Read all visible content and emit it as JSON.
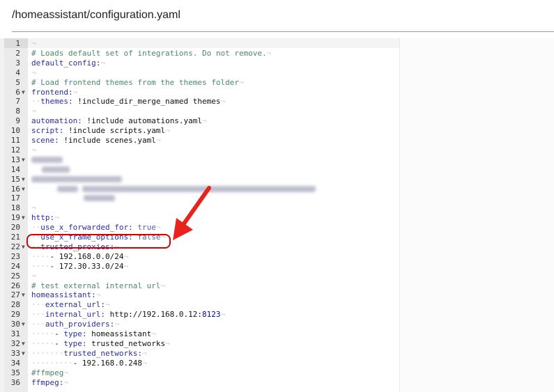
{
  "file": {
    "path": "/homeassistant/configuration.yaml"
  },
  "editor": {
    "lines": [
      {
        "n": "1",
        "code": ""
      },
      {
        "n": "2",
        "code": "# Loads default set of integrations. Do not remove."
      },
      {
        "n": "3",
        "code": "default_config:"
      },
      {
        "n": "4",
        "code": ""
      },
      {
        "n": "5",
        "code": "# Load frontend themes from the themes folder"
      },
      {
        "n": "6",
        "code": "frontend:",
        "fold": true
      },
      {
        "n": "7",
        "code": "  themes: !include_dir_merge_named themes"
      },
      {
        "n": "8",
        "code": ""
      },
      {
        "n": "9",
        "code": "automation: !include automations.yaml"
      },
      {
        "n": "10",
        "code": "script: !include scripts.yaml"
      },
      {
        "n": "11",
        "code": "scene: !include scenes.yaml"
      },
      {
        "n": "12",
        "code": ""
      },
      {
        "n": "13",
        "code": "",
        "fold": true
      },
      {
        "n": "14",
        "code": ""
      },
      {
        "n": "15",
        "code": "",
        "fold": true
      },
      {
        "n": "16",
        "code": "",
        "fold": true
      },
      {
        "n": "17",
        "code": ""
      },
      {
        "n": "18",
        "code": ""
      },
      {
        "n": "19",
        "code": "http:",
        "fold": true
      },
      {
        "n": "20",
        "code": "  use_x_forwarded_for: true"
      },
      {
        "n": "21",
        "code": "  use_x_frame_options: false"
      },
      {
        "n": "22",
        "code": "  trusted_proxies:",
        "fold": true
      },
      {
        "n": "23",
        "code": "    - 192.168.0.0/24"
      },
      {
        "n": "24",
        "code": "    - 172.30.33.0/24"
      },
      {
        "n": "25",
        "code": ""
      },
      {
        "n": "26",
        "code": "# test external internal url"
      },
      {
        "n": "27",
        "code": "homeassistant:",
        "fold": true
      },
      {
        "n": "28",
        "code": "   external_url:"
      },
      {
        "n": "29",
        "code": "   internal_url: http://192.168.0.12:8123"
      },
      {
        "n": "30",
        "code": "   auth_providers:",
        "fold": true
      },
      {
        "n": "31",
        "code": "     - type: homeassistant"
      },
      {
        "n": "32",
        "code": "     - type: trusted_networks",
        "fold": true
      },
      {
        "n": "33",
        "code": "       trusted_networks:",
        "fold": true
      },
      {
        "n": "34",
        "code": "         - 192.168.0.248"
      },
      {
        "n": "35",
        "code": "#ffmpeg"
      },
      {
        "n": "36",
        "code": "ffmpeg:"
      }
    ]
  },
  "colors": {
    "highlight": "#d40000",
    "arrow": "#e8231b"
  }
}
